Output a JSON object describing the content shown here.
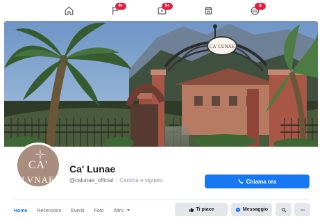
{
  "colors": {
    "brand_blue": "#1877f2",
    "badge_red": "#e41e3f",
    "muted_text": "#65676b",
    "button_gray": "#e4e6eb"
  },
  "top_nav": {
    "items": [
      {
        "name": "home-icon"
      },
      {
        "name": "flag-icon",
        "badge": "9+"
      },
      {
        "name": "watch-icon",
        "badge": "9+"
      },
      {
        "name": "marketplace-icon"
      },
      {
        "name": "gaming-icon",
        "badge": "6"
      }
    ]
  },
  "cover": {
    "sign_text": "CA' LUNAE"
  },
  "profile": {
    "avatar_top_text": "CA'",
    "avatar_bottom_text": "LVNAE",
    "page_name": "Ca' Lunae",
    "handle": "@calunae_official",
    "separator": "·",
    "category": "Cantina e vigneto"
  },
  "call_button": {
    "label": "Chiama ora",
    "icon": "phone-icon"
  },
  "tabs": [
    {
      "label": "Home",
      "active": true
    },
    {
      "label": "Recensioni",
      "active": false
    },
    {
      "label": "Eventi",
      "active": false
    },
    {
      "label": "Foto",
      "active": false
    },
    {
      "label": "Altro",
      "active": false,
      "dropdown": true
    }
  ],
  "actions": {
    "like_label": "Ti piace",
    "message_label": "Messaggio",
    "search_icon": "search-icon",
    "more_icon": "more-icon"
  }
}
